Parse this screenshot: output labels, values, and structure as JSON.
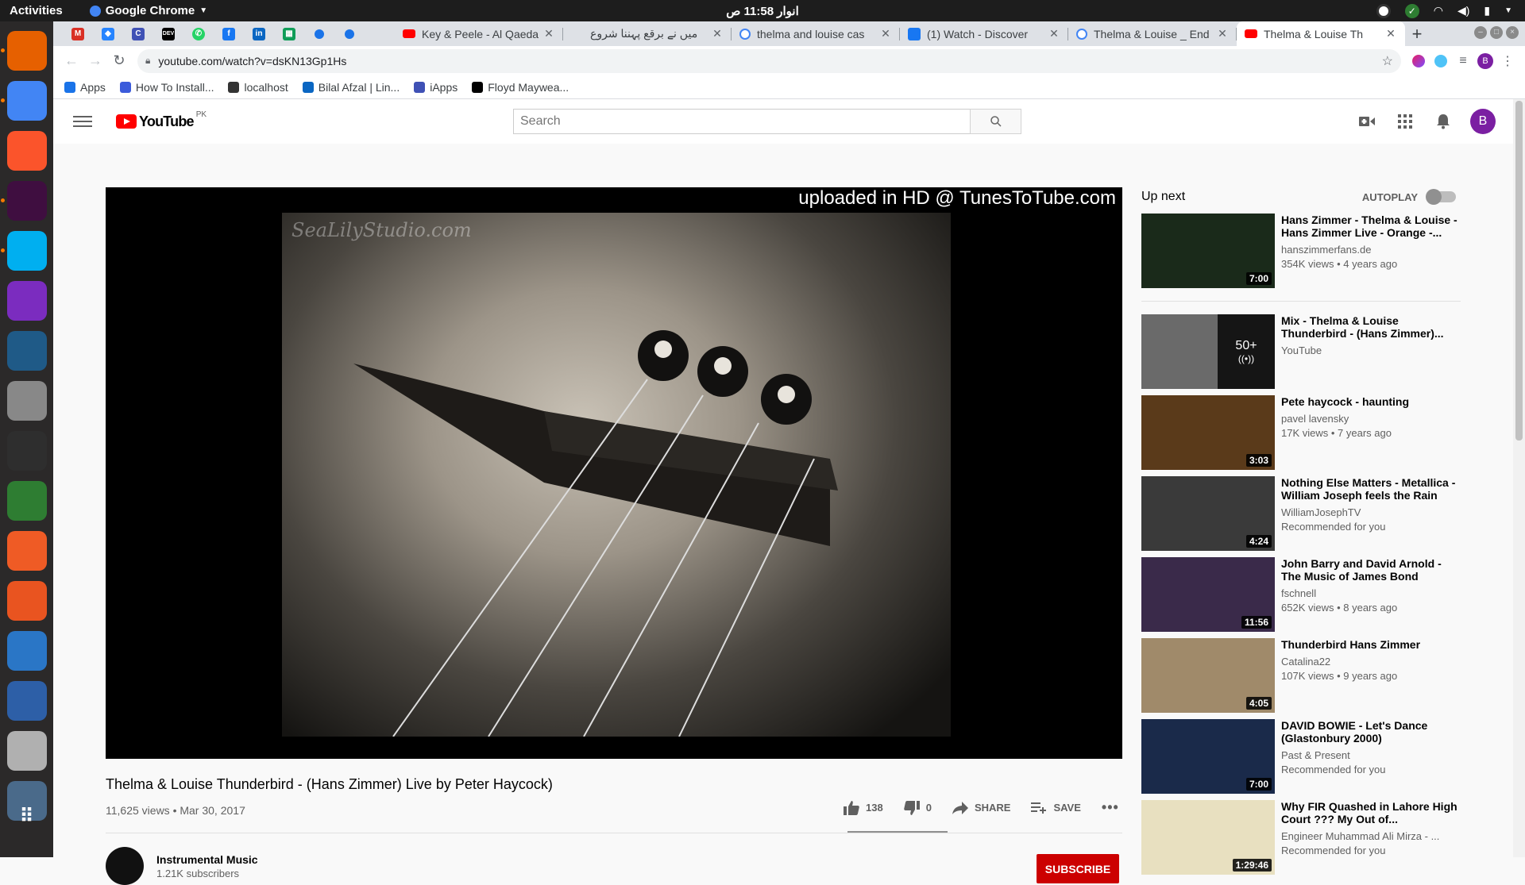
{
  "os": {
    "activities": "Activities",
    "app_name": "Google Chrome",
    "clock": "انوار 11:58 ص"
  },
  "dock": {
    "items": [
      {
        "name": "firefox",
        "color": "#e66000"
      },
      {
        "name": "chrome",
        "color": "#4285f4"
      },
      {
        "name": "brave",
        "color": "#fb542b"
      },
      {
        "name": "slack",
        "color": "#ffffff"
      },
      {
        "name": "skype",
        "color": "#00aff0"
      },
      {
        "name": "phpstorm",
        "color": "#7b2cbf"
      },
      {
        "name": "mysql-workbench",
        "color": "#1f5a87"
      },
      {
        "name": "file-manager",
        "color": "#888888"
      },
      {
        "name": "terminal",
        "color": "#2e2e2e"
      },
      {
        "name": "robo3t",
        "color": "#2e7d32"
      },
      {
        "name": "postman",
        "color": "#ef5b25"
      },
      {
        "name": "software-center",
        "color": "#e95420"
      },
      {
        "name": "help",
        "color": "#2a76c6"
      },
      {
        "name": "thunderbird",
        "color": "#2d5fa7"
      },
      {
        "name": "rhythmbox",
        "color": "#b0b0b0"
      },
      {
        "name": "screen",
        "color": "#4a6a8a"
      }
    ]
  },
  "chrome": {
    "tabs": [
      {
        "title": "Key & Peele - Al Qaeda",
        "favicon": "youtube",
        "active": false
      },
      {
        "title": "میں نے برقع پہننا شروع",
        "favicon": "generic",
        "active": false
      },
      {
        "title": "thelma and louise cas",
        "favicon": "google",
        "active": false
      },
      {
        "title": "(1) Watch - Discover",
        "favicon": "facebook",
        "active": false
      },
      {
        "title": "Thelma & Louise _ End",
        "favicon": "google",
        "active": false
      },
      {
        "title": "Thelma & Louise Th",
        "favicon": "youtube",
        "active": true
      }
    ],
    "url": "youtube.com/watch?v=dsKN13Gp1Hs",
    "bookmarks": [
      {
        "label": "Apps"
      },
      {
        "label": "How To Install..."
      },
      {
        "label": "localhost"
      },
      {
        "label": "Bilal Afzal | Lin..."
      },
      {
        "label": "iApps"
      },
      {
        "label": "Floyd Maywea..."
      }
    ],
    "profile_initial": "B"
  },
  "youtube": {
    "logo_text": "YouTube",
    "country": "PK",
    "search_placeholder": "Search",
    "avatar_initial": "B",
    "player_overlay": "uploaded in HD @ TunesToTube.com",
    "watermark": "SeaLilyStudio.com",
    "video": {
      "title": "Thelma & Louise Thunderbird - (Hans Zimmer) Live by Peter Haycock)",
      "views_date": "11,625 views • Mar 30, 2017",
      "likes": "138",
      "dislikes": "0",
      "share": "SHARE",
      "save": "SAVE"
    },
    "channel": {
      "name": "Instrumental Music",
      "subs": "1.21K subscribers",
      "subscribe": "SUBSCRIBE"
    },
    "upnext": {
      "label": "Up next",
      "autoplay": "AUTOPLAY",
      "items": [
        {
          "title": "Hans Zimmer - Thelma & Louise - Hans Zimmer Live - Orange -...",
          "channel": "hanszimmerfans.de",
          "meta": "354K views • 4 years ago",
          "duration": "7:00",
          "thumb": "#1a2a1a"
        },
        {
          "title": "Mix - Thelma & Louise Thunderbird - (Hans Zimmer)...",
          "channel": "YouTube",
          "meta": "",
          "duration": "",
          "mix_count": "50+",
          "thumb": "#6a6a6a"
        },
        {
          "title": "Pete haycock - haunting",
          "channel": "pavel lavensky",
          "meta": "17K views • 7 years ago",
          "duration": "3:03",
          "thumb": "#5a3a1a"
        },
        {
          "title": "Nothing Else Matters - Metallica - William Joseph feels the Rain",
          "channel": "WilliamJosephTV",
          "meta": "Recommended for you",
          "duration": "4:24",
          "thumb": "#3a3a3a"
        },
        {
          "title": "John Barry and David Arnold - The Music of James Bond",
          "channel": "fschnell",
          "meta": "652K views • 8 years ago",
          "duration": "11:56",
          "thumb": "#3a2a4a"
        },
        {
          "title": "Thunderbird Hans Zimmer",
          "channel": "Catalina22",
          "meta": "107K views • 9 years ago",
          "duration": "4:05",
          "thumb": "#a08a6a"
        },
        {
          "title": "DAVID BOWIE - Let's Dance (Glastonbury 2000)",
          "channel": "Past & Present",
          "meta": "Recommended for you",
          "duration": "7:00",
          "thumb": "#1a2a4a"
        },
        {
          "title": "Why FIR Quashed in Lahore High Court ??? My Out of...",
          "channel": "Engineer Muhammad Ali Mirza - ...",
          "meta": "Recommended for you",
          "duration": "1:29:46",
          "thumb": "#e8e0c0"
        }
      ]
    }
  }
}
